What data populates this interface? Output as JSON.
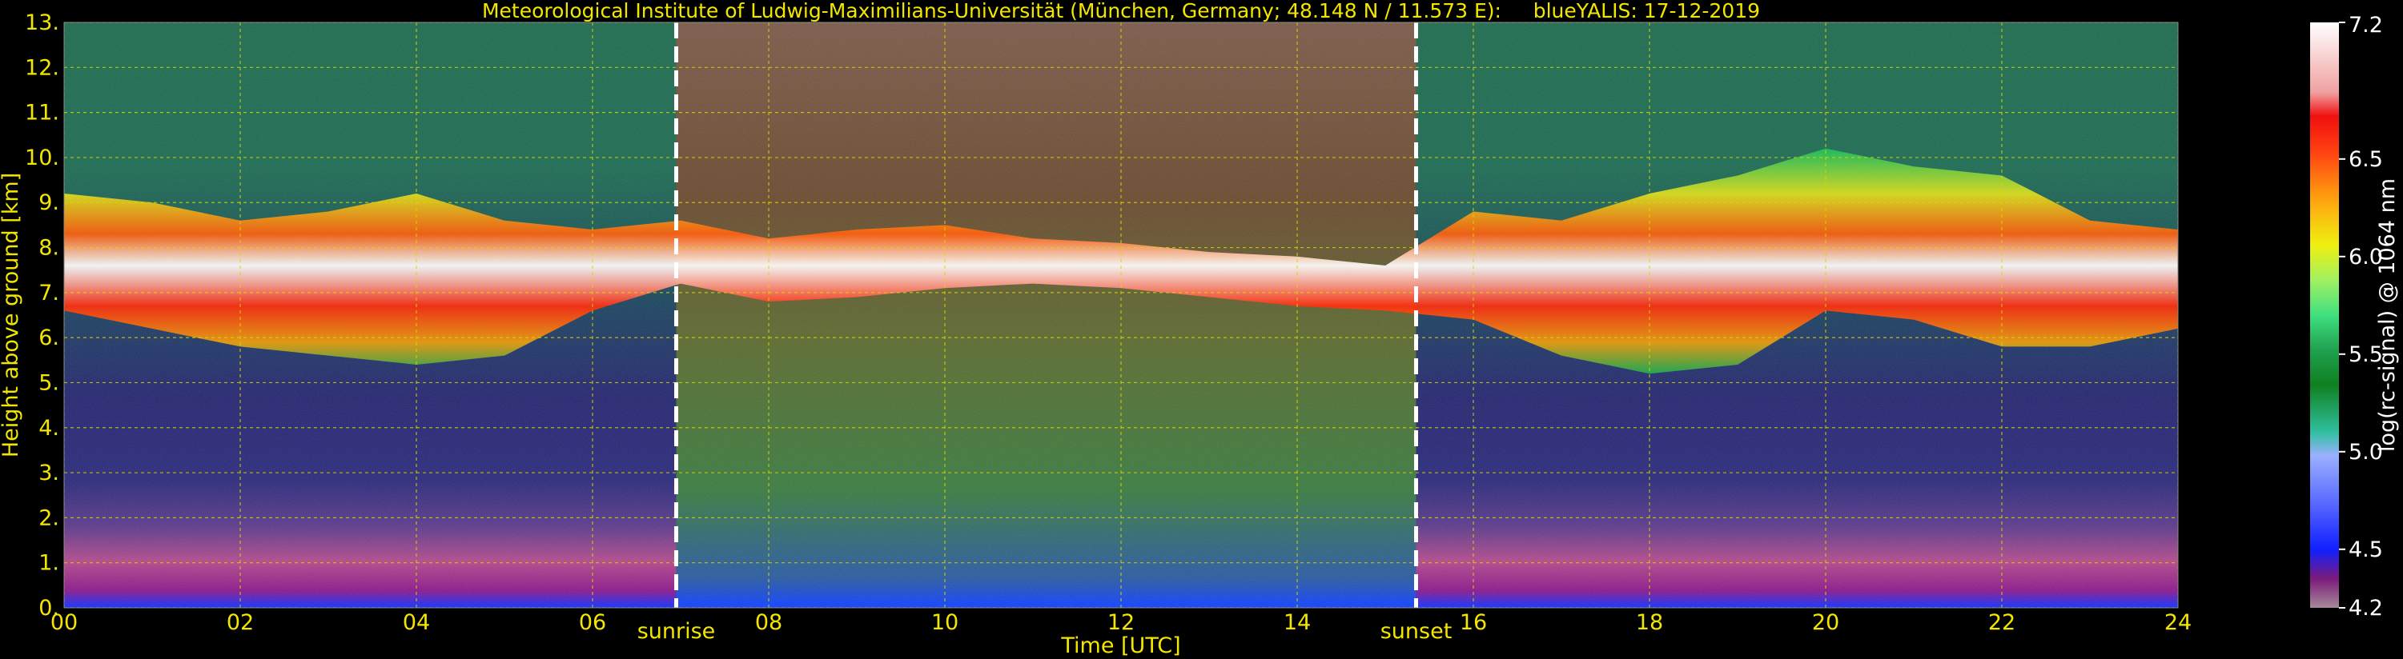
{
  "chart_data": {
    "type": "heatmap",
    "title": "Meteorological Institute of Ludwig-Maximilians-Universität (München, Germany; 48.148 N / 11.573 E):     blueYALIS: 17-12-2019",
    "xlabel": "Time [UTC]",
    "ylabel": "Height above ground [km]",
    "xlim": [
      0,
      24
    ],
    "ylim": [
      0,
      13
    ],
    "x_ticks": [
      0,
      2,
      4,
      6,
      8,
      10,
      12,
      14,
      16,
      18,
      20,
      22,
      24
    ],
    "x_tick_labels": [
      "00",
      "02",
      "04",
      "06",
      "08",
      "10",
      "12",
      "14",
      "16",
      "18",
      "20",
      "22",
      "24"
    ],
    "y_ticks": [
      0,
      1,
      2,
      3,
      4,
      5,
      6,
      7,
      8,
      9,
      10,
      11,
      12,
      13
    ],
    "y_tick_labels": [
      "0.",
      "1.",
      "2.",
      "3.",
      "4.",
      "5.",
      "6.",
      "7.",
      "8.",
      "9.",
      "10.",
      "11.",
      "12.",
      "13."
    ],
    "grid": true,
    "vlines": [
      {
        "x": 6.95,
        "label": "sunrise"
      },
      {
        "x": 15.35,
        "label": "sunset"
      }
    ],
    "colorbar": {
      "label": "log(rc-signal) @ 1064 nm",
      "range": [
        4.2,
        7.2
      ],
      "tick_values": [
        4.2,
        4.5,
        5.0,
        5.5,
        6.0,
        6.5,
        7.2
      ],
      "tick_labels": [
        "4.2",
        "4.5",
        "5.0",
        "5.5",
        "6.0",
        "6.5",
        "7.2"
      ]
    },
    "cloud_layer_estimate": {
      "x": [
        0,
        1,
        2,
        3,
        4,
        5,
        6,
        7,
        8,
        9,
        10,
        11,
        12,
        13,
        14,
        15,
        16,
        17,
        18,
        19,
        20,
        21,
        22,
        23,
        24
      ],
      "top_km": [
        9.2,
        9.0,
        8.6,
        8.8,
        9.2,
        8.6,
        8.4,
        8.6,
        8.2,
        8.4,
        8.5,
        8.2,
        8.1,
        7.9,
        7.8,
        7.6,
        8.8,
        8.6,
        9.2,
        9.6,
        10.2,
        9.8,
        9.6,
        8.6,
        8.4
      ],
      "bottom_km": [
        6.6,
        6.2,
        5.8,
        5.6,
        5.4,
        5.6,
        6.6,
        7.2,
        6.8,
        6.9,
        7.1,
        7.2,
        7.1,
        6.9,
        6.7,
        6.6,
        6.4,
        5.6,
        5.2,
        5.4,
        6.6,
        6.4,
        5.8,
        5.8,
        6.2
      ]
    }
  }
}
